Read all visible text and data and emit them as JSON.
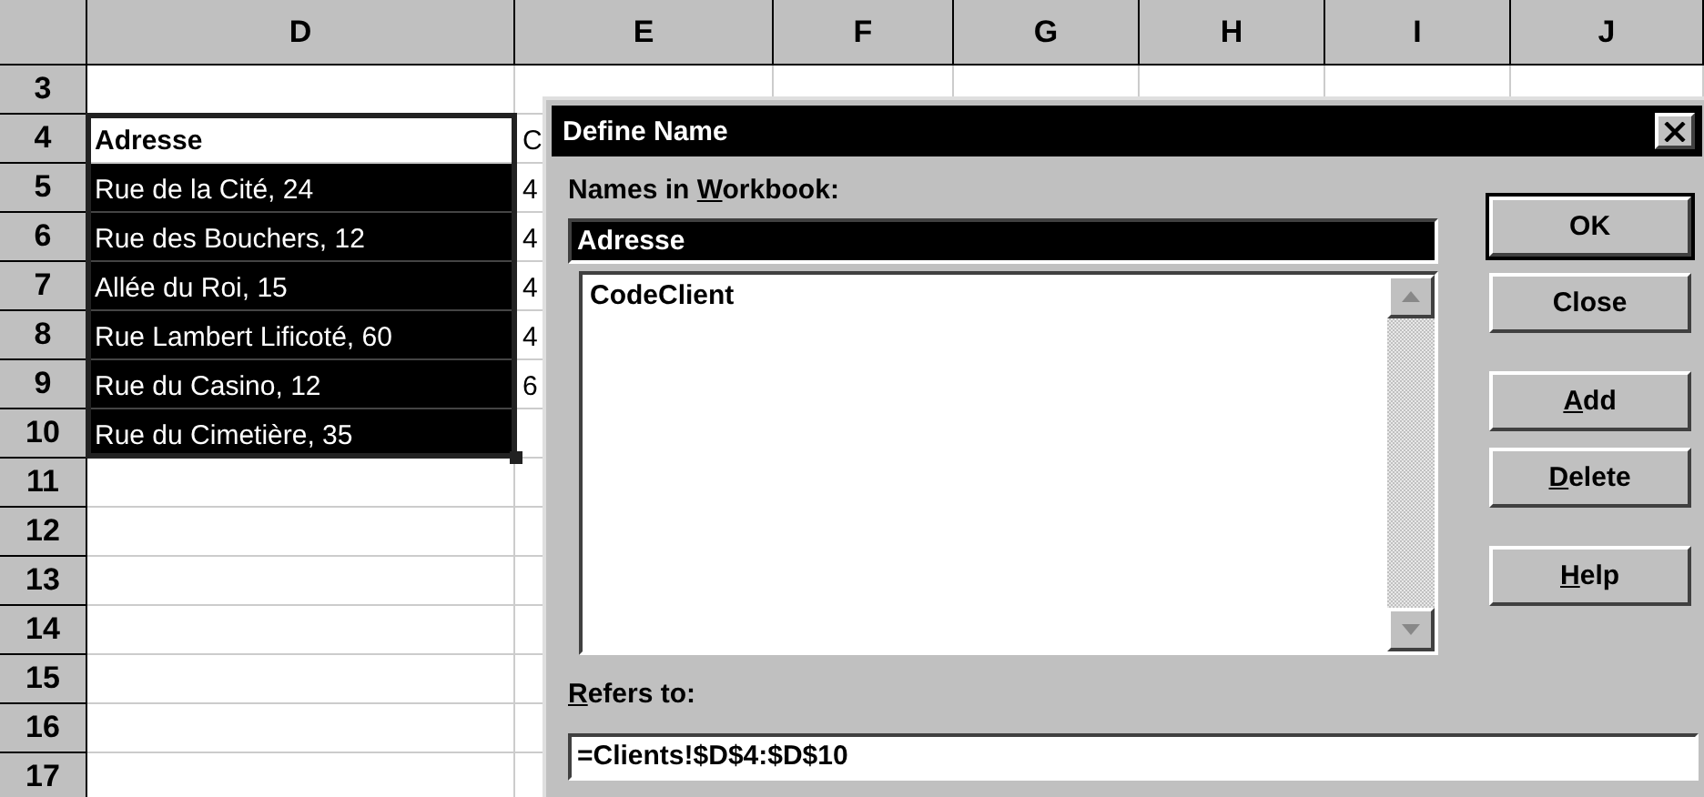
{
  "sheet": {
    "columns": [
      "D",
      "E",
      "F",
      "G",
      "H",
      "I",
      "J"
    ],
    "rows": [
      {
        "number": "3"
      },
      {
        "number": "4",
        "address": {
          "text": "Adresse",
          "active": true,
          "selected": false,
          "header": true
        },
        "column_e": "C"
      },
      {
        "number": "5",
        "address": {
          "text": "Rue de la Cité, 24",
          "active": false,
          "selected": true,
          "header": false
        },
        "column_e": "4"
      },
      {
        "number": "6",
        "address": {
          "text": "Rue des Bouchers, 12",
          "active": false,
          "selected": true,
          "header": false
        },
        "column_e": "4"
      },
      {
        "number": "7",
        "address": {
          "text": "Allée du Roi, 15",
          "active": false,
          "selected": true,
          "header": false
        },
        "column_e": "4"
      },
      {
        "number": "8",
        "address": {
          "text": "Rue Lambert Lificoté, 60",
          "active": false,
          "selected": true,
          "header": false
        },
        "column_e": "4"
      },
      {
        "number": "9",
        "address": {
          "text": "Rue du Casino, 12",
          "active": false,
          "selected": true,
          "header": false
        },
        "column_e": "6"
      },
      {
        "number": "10",
        "address": {
          "text": "Rue du Cimetière, 35",
          "active": false,
          "selected": true,
          "header": false
        }
      },
      {
        "number": "11"
      },
      {
        "number": "12"
      },
      {
        "number": "13"
      },
      {
        "number": "14"
      },
      {
        "number": "15"
      },
      {
        "number": "16"
      },
      {
        "number": "17"
      }
    ]
  },
  "dialog": {
    "title": "Define Name",
    "names_label": {
      "before": "Names in ",
      "key": "W",
      "after": "orkbook:"
    },
    "name_field": {
      "value": "Adresse",
      "selected": true
    },
    "names_list": [
      {
        "label": "CodeClient",
        "selected": false
      }
    ],
    "refers_label": {
      "key": "R",
      "after": "efers to:"
    },
    "refers_field": {
      "value": "=Clients!$D$4:$D$10"
    },
    "button_groups": [
      [
        {
          "label": {
            "before": "OK"
          },
          "default": true
        },
        {
          "label": {
            "before": "Close"
          },
          "default": false
        }
      ],
      [
        {
          "label": {
            "key": "A",
            "after": "dd"
          },
          "default": false
        },
        {
          "label": {
            "key": "D",
            "after": "elete"
          },
          "default": false
        }
      ],
      [
        {
          "label": {
            "key": "H",
            "after": "elp"
          },
          "default": false
        }
      ]
    ]
  }
}
